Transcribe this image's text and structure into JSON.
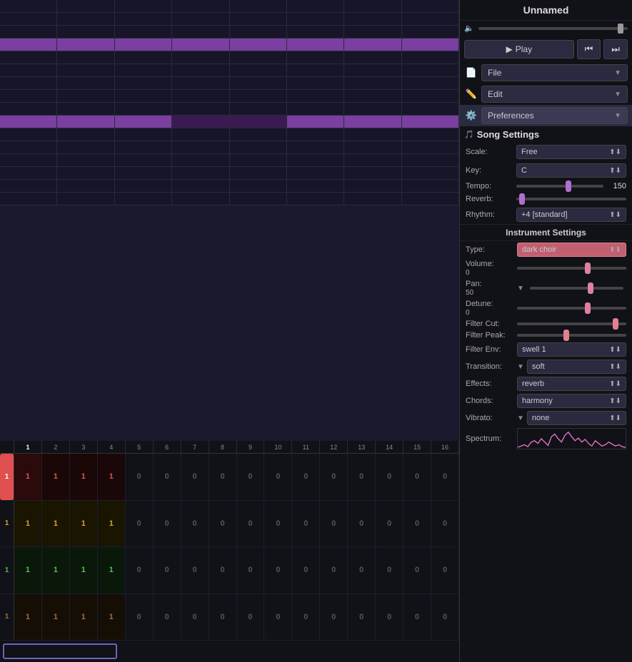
{
  "app": {
    "title": "Unnamed"
  },
  "transport": {
    "play_label": "Play",
    "rewind_icon": "⏮",
    "forward_icon": "⏭",
    "play_icon": "▶"
  },
  "menus": {
    "file_label": "File",
    "edit_label": "Edit",
    "preferences_label": "Preferences"
  },
  "song_settings": {
    "title": "Song Settings",
    "scale_label": "Scale:",
    "scale_value": "Free",
    "key_label": "Key:",
    "key_value": "C",
    "tempo_label": "Tempo:",
    "tempo_value": "150",
    "reverb_label": "Reverb:",
    "rhythm_label": "Rhythm:",
    "rhythm_value": "+4 [standard]"
  },
  "instrument_settings": {
    "title": "Instrument Settings",
    "type_label": "Type:",
    "type_value": "dark choir",
    "volume_label": "Volume:",
    "volume_val": "0",
    "pan_label": "Pan:",
    "pan_val": "50",
    "detune_label": "Detune:",
    "detune_val": "0",
    "filtercut_label": "Filter Cut:",
    "filterpeak_label": "Filter Peak:",
    "filterenv_label": "Filter Env:",
    "filterenv_value": "swell 1",
    "transition_label": "Transition:",
    "transition_value": "soft",
    "effects_label": "Effects:",
    "effects_value": "reverb",
    "chords_label": "Chords:",
    "chords_value": "harmony",
    "vibrato_label": "Vibrato:",
    "vibrato_value": "none",
    "spectrum_label": "Spectrum:"
  },
  "grid": {
    "col_numbers": [
      "1",
      "2",
      "3",
      "4",
      "5",
      "6",
      "7",
      "8",
      "9",
      "10",
      "11",
      "12",
      "13",
      "14",
      "15",
      "16"
    ],
    "rows": [
      {
        "label": "1",
        "color": "active-red",
        "values": [
          1,
          1,
          1,
          1,
          0,
          0,
          0,
          0,
          0,
          0,
          0,
          0,
          0,
          0,
          0,
          0
        ]
      },
      {
        "label": "1",
        "color": "yellow",
        "values": [
          1,
          1,
          1,
          1,
          0,
          0,
          0,
          0,
          0,
          0,
          0,
          0,
          0,
          0,
          0,
          0
        ]
      },
      {
        "label": "1",
        "color": "green",
        "values": [
          1,
          1,
          1,
          1,
          0,
          0,
          0,
          0,
          0,
          0,
          0,
          0,
          0,
          0,
          0,
          0
        ]
      },
      {
        "label": "1",
        "color": "brown",
        "values": [
          1,
          1,
          1,
          1,
          0,
          0,
          0,
          0,
          0,
          0,
          0,
          0,
          0,
          0,
          0,
          0
        ]
      }
    ]
  }
}
